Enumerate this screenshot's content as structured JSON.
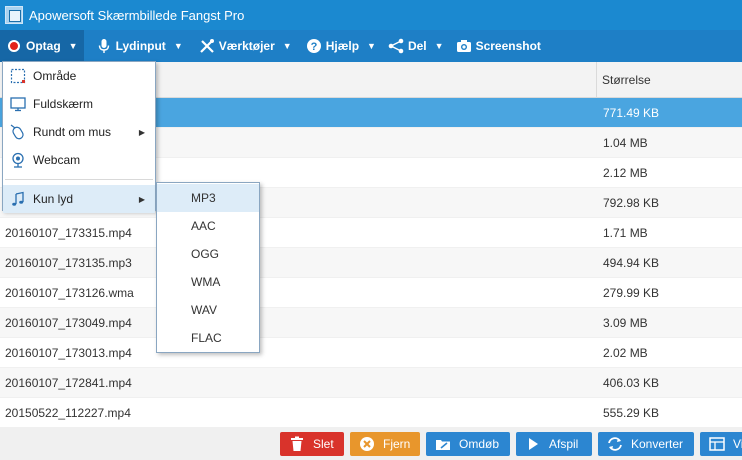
{
  "window": {
    "title": "Apowersoft Skærmbillede Fangst Pro"
  },
  "toolbar": {
    "record": "Optag",
    "audio_input": "Lydinput",
    "tools": "Værktøjer",
    "help": "Hjælp",
    "share": "Del",
    "screenshot": "Screenshot"
  },
  "list": {
    "size_header": "Størrelse",
    "rows": [
      {
        "name": "",
        "size": "771.49 KB"
      },
      {
        "name": "",
        "size": "1.04 MB"
      },
      {
        "name": "",
        "size": "2.12 MB"
      },
      {
        "name": "",
        "size": "792.98 KB"
      },
      {
        "name": "20160107_173315.mp4",
        "size": "1.71 MB"
      },
      {
        "name": "20160107_173135.mp3",
        "size": "494.94 KB"
      },
      {
        "name": "20160107_173126.wma",
        "size": "279.99 KB"
      },
      {
        "name": "20160107_173049.mp4",
        "size": "3.09 MB"
      },
      {
        "name": "20160107_173013.mp4",
        "size": "2.02 MB"
      },
      {
        "name": "20160107_172841.mp4",
        "size": "406.03 KB"
      },
      {
        "name": "20150522_112227.mp4",
        "size": "555.29 KB"
      }
    ]
  },
  "record_menu": {
    "region": "Område",
    "fullscreen": "Fuldskærm",
    "around_mouse": "Rundt om mus",
    "webcam": "Webcam",
    "audio_only": "Kun lyd"
  },
  "audio_submenu": [
    "MP3",
    "AAC",
    "OGG",
    "WMA",
    "WAV",
    "FLAC"
  ],
  "buttons": {
    "delete": "Slet",
    "remove": "Fjern",
    "rename": "Omdøb",
    "play": "Afspil",
    "convert": "Konverter",
    "view": "Vi"
  },
  "colors": {
    "titlebar": "#1b89d0",
    "toolbar": "#1e7fc6",
    "selected_row": "#4aa5e0",
    "delete": "#d9332b",
    "remove": "#e8962c",
    "action": "#2c86d1"
  }
}
